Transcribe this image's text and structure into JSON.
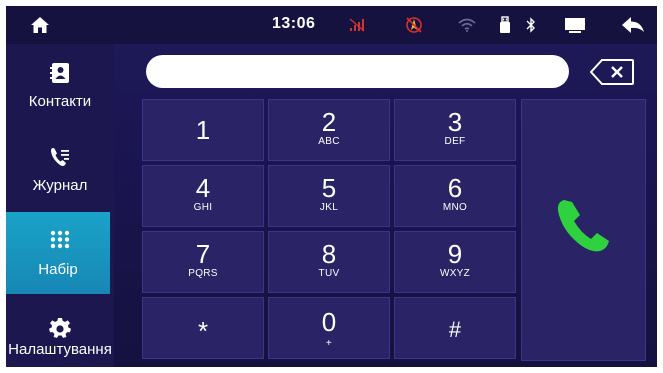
{
  "status_bar": {
    "time": "13:06",
    "icons": [
      "home-icon",
      "no-signal-icon",
      "navigation-icon",
      "wifi-icon",
      "usb-icon",
      "bluetooth-icon",
      "screen-icon",
      "back-arrow-icon"
    ]
  },
  "sidebar": {
    "items": [
      {
        "label": "Контакти",
        "icon": "contacts-icon"
      },
      {
        "label": "Журнал",
        "icon": "call-log-icon"
      },
      {
        "label": "Набір",
        "icon": "dialpad-icon"
      },
      {
        "label": "Налаштування",
        "icon": "gear-icon"
      }
    ],
    "active_index": 2
  },
  "dialer": {
    "number_value": "",
    "keys": [
      {
        "digit": "1",
        "letters": ""
      },
      {
        "digit": "2",
        "letters": "ABC"
      },
      {
        "digit": "3",
        "letters": "DEF"
      },
      {
        "digit": "4",
        "letters": "GHI"
      },
      {
        "digit": "5",
        "letters": "JKL"
      },
      {
        "digit": "6",
        "letters": "MNO"
      },
      {
        "digit": "7",
        "letters": "PQRS"
      },
      {
        "digit": "8",
        "letters": "TUV"
      },
      {
        "digit": "9",
        "letters": "WXYZ"
      },
      {
        "digit": "*",
        "letters": ""
      },
      {
        "digit": "0",
        "letters": "+"
      },
      {
        "digit": "#",
        "letters": ""
      }
    ],
    "call_icon": "phone-icon",
    "backspace_icon": "backspace-icon"
  },
  "colors": {
    "background": "#1a1550",
    "key_fill": "#2a2366",
    "active_tab": "#1aa3c9",
    "call_green": "#2fd13f",
    "signal_red": "#d9302c"
  }
}
